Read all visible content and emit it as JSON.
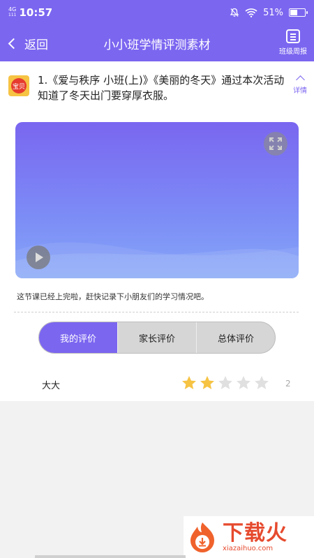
{
  "status_bar": {
    "network": "4G",
    "network_sub": "111",
    "time": "10:57",
    "battery_text": "51%",
    "battery_level": 0.51
  },
  "nav": {
    "back_label": "返回",
    "title": "小小班学情评测素材",
    "weekly_label": "班级周报"
  },
  "lesson": {
    "text": "1.《爱与秩序 小班(上)》《美丽的冬天》通过本次活动知道了冬天出门要穿厚衣服。",
    "detail_label": "详情",
    "thumb_text": "宝贝"
  },
  "notice": "这节课已经上完啦，赶快记录下小朋友们的学习情况吧。",
  "tabs": [
    {
      "label": "我的评价",
      "active": true
    },
    {
      "label": "家长评价",
      "active": false
    },
    {
      "label": "总体评价",
      "active": false
    }
  ],
  "rating": {
    "name": "大大",
    "stars_filled": 2,
    "stars_total": 5,
    "score": "2"
  },
  "colors": {
    "accent": "#7b66f0",
    "star_on": "#f6c343",
    "star_off": "#e0e0e0"
  },
  "watermark": {
    "big": "下载火",
    "small": "xiazaihuo.com"
  }
}
